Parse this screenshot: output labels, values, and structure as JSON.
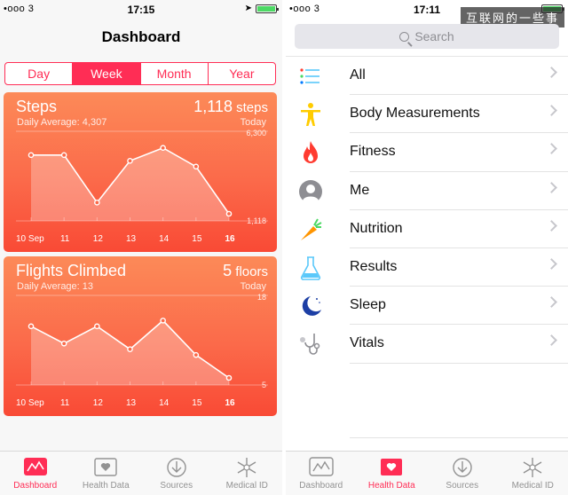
{
  "left": {
    "status": {
      "carrier": "•ooo 3",
      "time": "17:15"
    },
    "title": "Dashboard",
    "segments": [
      {
        "label": "Day",
        "active": false
      },
      {
        "label": "Week",
        "active": true
      },
      {
        "label": "Month",
        "active": false
      },
      {
        "label": "Year",
        "active": false
      }
    ],
    "steps_card": {
      "title": "Steps",
      "subtitle": "Daily Average: 4,307",
      "value": "1,118",
      "unit": " steps",
      "period": "Today"
    },
    "flights_card": {
      "title": "Flights Climbed",
      "subtitle": "Daily Average: 13",
      "value": "5",
      "unit": " floors",
      "period": "Today"
    },
    "tabs": [
      {
        "label": "Dashboard",
        "icon": "dashboard-icon",
        "active": true
      },
      {
        "label": "Health Data",
        "icon": "health-data-icon",
        "active": false
      },
      {
        "label": "Sources",
        "icon": "sources-icon",
        "active": false
      },
      {
        "label": "Medical ID",
        "icon": "medical-id-icon",
        "active": false
      }
    ]
  },
  "right": {
    "status": {
      "carrier": "•ooo 3",
      "time": "17:11"
    },
    "watermark": "互联网的一些事",
    "search_placeholder": "Search",
    "items": [
      {
        "label": "All",
        "icon": "list-icon"
      },
      {
        "label": "Body Measurements",
        "icon": "body-figure-icon"
      },
      {
        "label": "Fitness",
        "icon": "flame-icon"
      },
      {
        "label": "Me",
        "icon": "person-icon"
      },
      {
        "label": "Nutrition",
        "icon": "carrot-icon"
      },
      {
        "label": "Results",
        "icon": "flask-icon"
      },
      {
        "label": "Sleep",
        "icon": "moon-icon"
      },
      {
        "label": "Vitals",
        "icon": "stethoscope-icon"
      }
    ],
    "tabs": [
      {
        "label": "Dashboard",
        "icon": "dashboard-icon",
        "active": false
      },
      {
        "label": "Health Data",
        "icon": "health-data-icon",
        "active": true
      },
      {
        "label": "Sources",
        "icon": "sources-icon",
        "active": false
      },
      {
        "label": "Medical ID",
        "icon": "medical-id-icon",
        "active": false
      }
    ]
  },
  "chart_data": [
    {
      "type": "area",
      "title": "Steps",
      "categories": [
        "10 Sep",
        "11",
        "12",
        "13",
        "14",
        "15",
        "16"
      ],
      "values": [
        5200,
        5200,
        1900,
        4800,
        5700,
        4400,
        1118
      ],
      "ylim": [
        1118,
        6300
      ],
      "ytick_labels": [
        "6,300",
        "1,118"
      ]
    },
    {
      "type": "area",
      "title": "Flights Climbed",
      "categories": [
        "10 Sep",
        "11",
        "12",
        "13",
        "14",
        "15",
        "16"
      ],
      "values": [
        14,
        11,
        14,
        10,
        15,
        9,
        5
      ],
      "ylim": [
        5,
        18
      ],
      "ytick_labels": [
        "18",
        "5"
      ]
    }
  ],
  "colors": {
    "accent": "#ff2d55",
    "card_top": "#fc8a58",
    "card_bottom": "#f94a35",
    "tab_inactive": "#929292"
  }
}
